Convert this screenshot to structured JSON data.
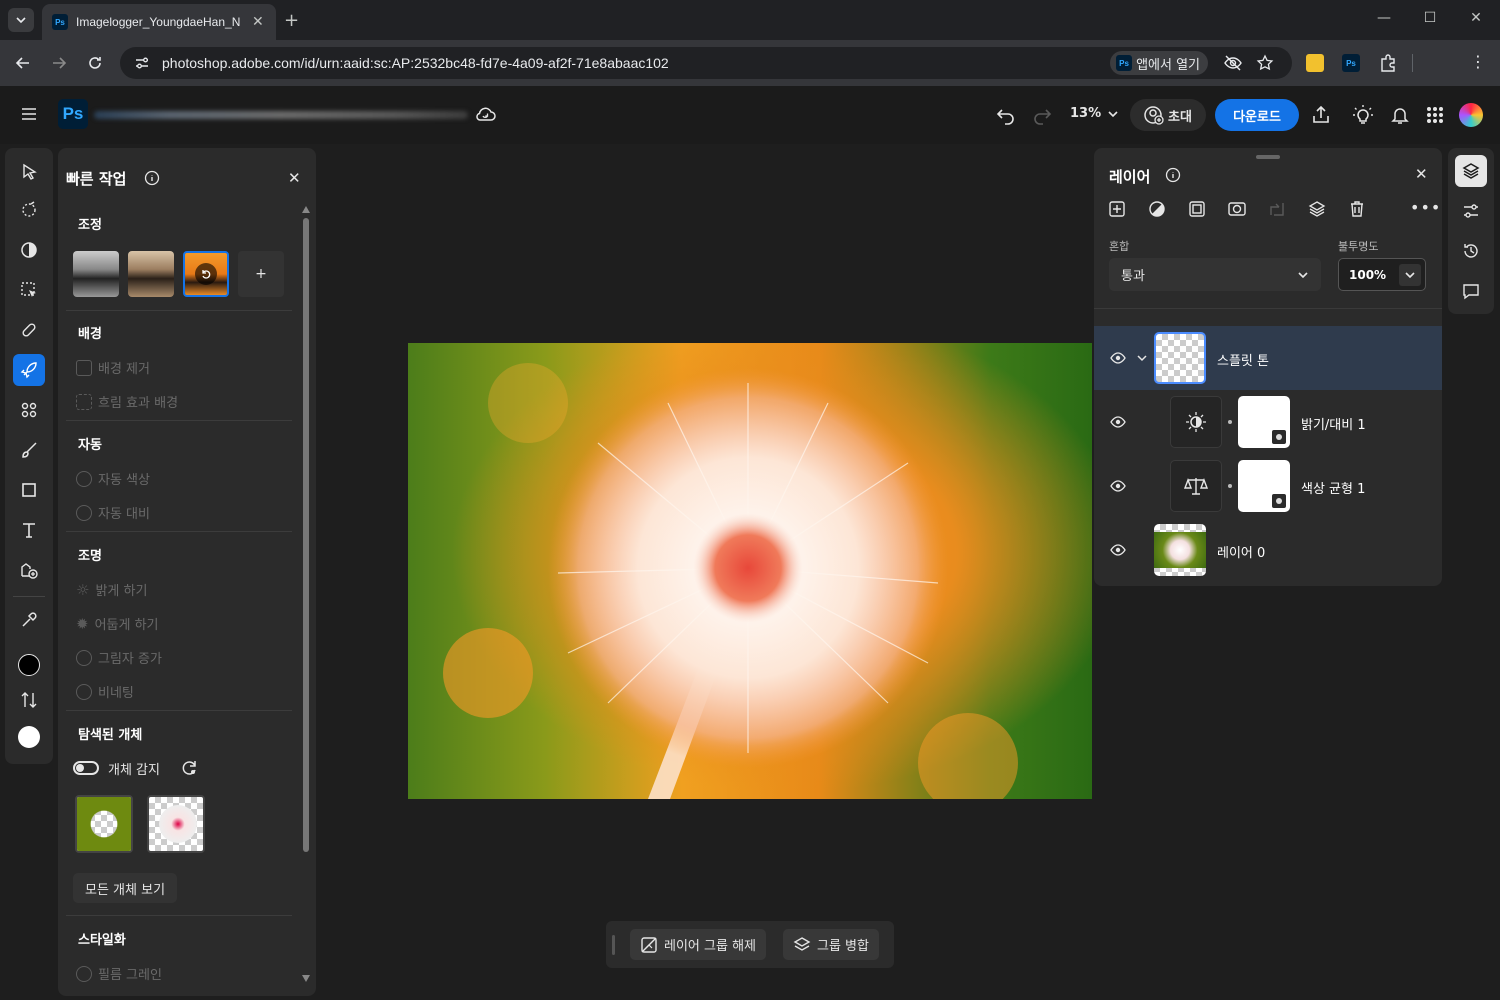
{
  "browser": {
    "tab_title": "Imagelogger_YoungdaeHan_N",
    "url": "photoshop.adobe.com/id/urn:aaid:sc:AP:2532bc48-fd7e-4a09-af2f-71e8abaac102",
    "open_in_app_label": "앱에서 열기"
  },
  "app": {
    "logo": "Ps",
    "zoom": "13%",
    "invite_label": "초대",
    "download_label": "다운로드"
  },
  "quick_actions": {
    "title": "빠른 작업",
    "sections": {
      "adjust": "조정",
      "background": "배경",
      "remove_bg": "배경 제거",
      "blur_bg": "흐림 효과 배경",
      "auto": "자동",
      "auto_color": "자동 색상",
      "auto_contrast": "자동 대비",
      "lighting": "조명",
      "brighten": "밝게 하기",
      "darken": "어둡게 하기",
      "shadow": "그림자 증가",
      "vignette": "비네팅",
      "detected": "탐색된 개체",
      "object_detect": "개체 감지",
      "see_all": "모든 개체 보기",
      "stylize": "스타일화",
      "film_grain": "필름 그레인"
    },
    "add_label": "+"
  },
  "floatbar": {
    "ungroup": "레이어 그룹 해제",
    "merge": "그룹 병합"
  },
  "layers": {
    "title": "레이어",
    "blend_label": "혼합",
    "blend_value": "통과",
    "opacity_label": "불투명도",
    "opacity_value": "100%",
    "items": [
      {
        "name": "스플릿 톤"
      },
      {
        "name": "밝기/대비 1"
      },
      {
        "name": "색상 균형 1"
      },
      {
        "name": "레이어 0"
      }
    ]
  },
  "colors": {
    "accent": "#1473e6",
    "panel": "#2b2b2b",
    "background": "#1e1e1e",
    "selected_layer": "#2f3b4d"
  }
}
